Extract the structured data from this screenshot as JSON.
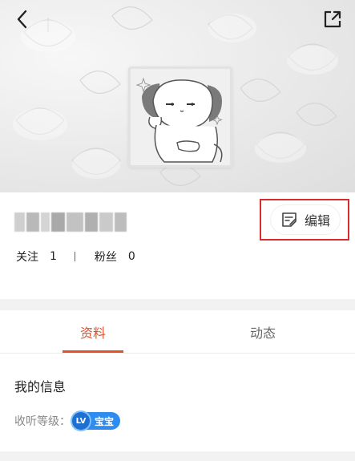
{
  "header": {
    "back_icon": "chevron-left-icon",
    "share_icon": "share-external-icon"
  },
  "avatar": {
    "icon": "cat-avatar"
  },
  "profile": {
    "username": "",
    "edit_label": "编辑",
    "follow_label": "关注",
    "follow_count": "1",
    "fans_label": "粉丝",
    "fans_count": "0"
  },
  "tabs": [
    {
      "label": "资料",
      "active": true
    },
    {
      "label": "动态",
      "active": false
    }
  ],
  "info": {
    "title": "我的信息",
    "level_label": "收听等级：",
    "level_badge_icon": "LV",
    "level_name": "宝宝"
  },
  "colors": {
    "accent": "#e0502a",
    "highlight_box": "#d92c2c",
    "badge_blue": "#2e8cf0"
  }
}
